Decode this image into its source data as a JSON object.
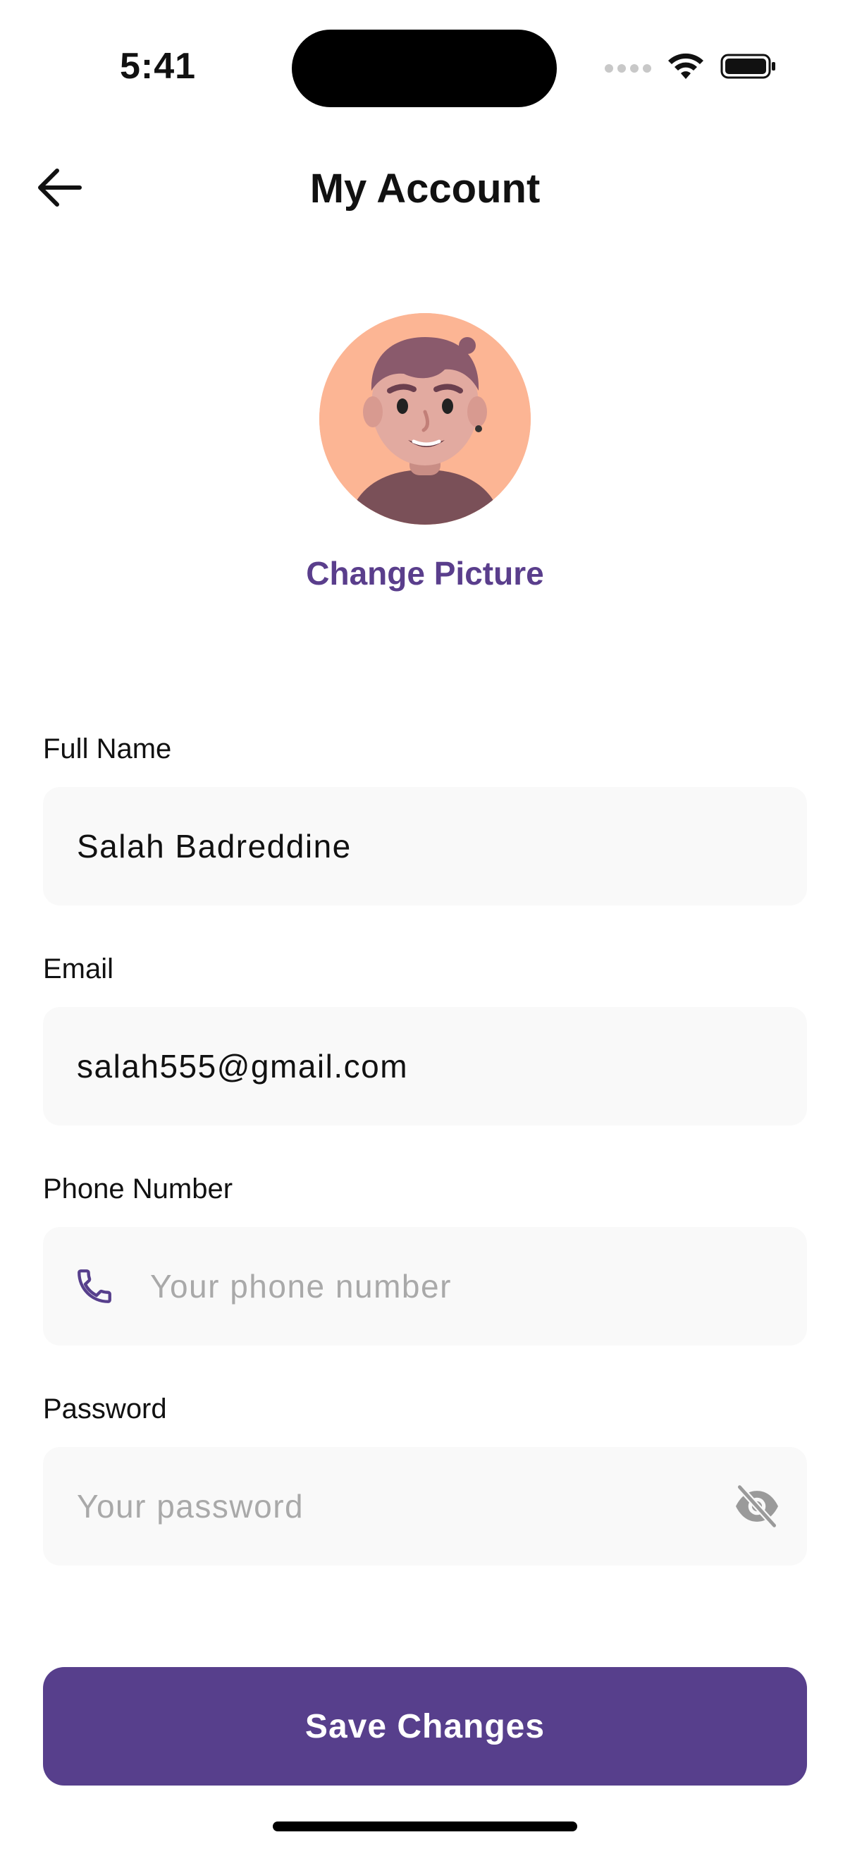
{
  "status_bar": {
    "time": "5:41"
  },
  "header": {
    "title": "My Account",
    "back_icon": "arrow-left-icon"
  },
  "profile": {
    "avatar_icon": "user-avatar-illustration",
    "change_picture_label": "Change Picture"
  },
  "form": {
    "full_name": {
      "label": "Full Name",
      "value": "Salah Badreddine",
      "placeholder": ""
    },
    "email": {
      "label": "Email",
      "value": "salah555@gmail.com",
      "placeholder": ""
    },
    "phone": {
      "label": "Phone Number",
      "value": "",
      "placeholder": "Your phone number",
      "icon": "phone-icon"
    },
    "password": {
      "label": "Password",
      "value": "",
      "placeholder": "Your password",
      "icon": "eye-off-icon"
    }
  },
  "actions": {
    "save_label": "Save Changes"
  },
  "colors": {
    "accent": "#573f8c",
    "accent_text": "#5a3e8c",
    "field_bg": "#f9f9f9",
    "avatar_bg": "#fcb594",
    "placeholder": "#a9a9a9"
  }
}
